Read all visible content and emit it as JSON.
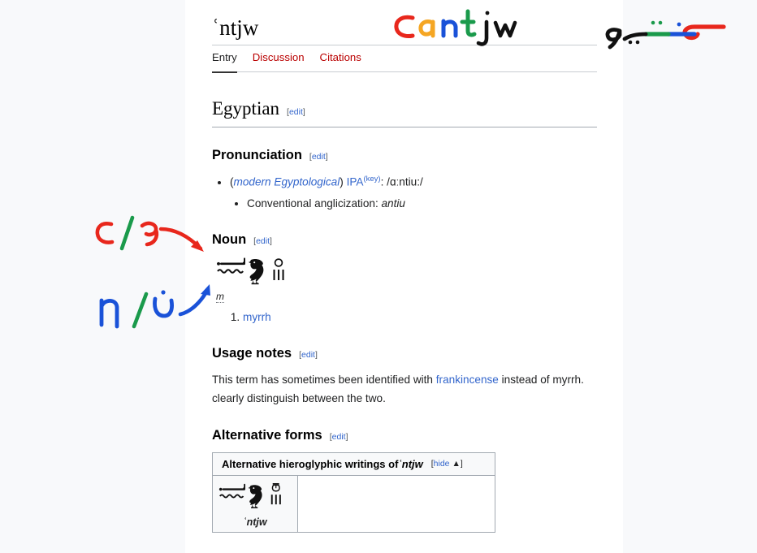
{
  "page": {
    "title": "ʿntjw",
    "background_color": "#f8f9fb",
    "content_color": "#ffffff"
  },
  "tabs": [
    {
      "label": "Entry",
      "selected": true,
      "color": "#202122"
    },
    {
      "label": "Discussion",
      "selected": false,
      "color": "#ba0000"
    },
    {
      "label": "Citations",
      "selected": false,
      "color": "#ba0000"
    }
  ],
  "language_section": {
    "heading": "Egyptian",
    "edit_open": "[",
    "edit_label": "edit",
    "edit_close": "]"
  },
  "pronunciation": {
    "heading": "Pronunciation",
    "register": "modern Egyptological",
    "ipa_label": "IPA",
    "ipa_key": "(key)",
    "ipa_colon": ":",
    "ipa_value": "/ɑːntiu:/",
    "anglicization_label": "Conventional anglicization:",
    "anglicization_value": "antiu",
    "open_paren": "(",
    "close_paren": ")"
  },
  "noun": {
    "heading": "Noun",
    "gender": "m",
    "definitions": [
      "myrrh"
    ]
  },
  "usage_notes": {
    "heading": "Usage notes",
    "text_before": "This term has sometimes been identified with ",
    "link": "frankincense",
    "text_after": " instead of myrrh.",
    "line2": "clearly distinguish between the two."
  },
  "alternative_forms": {
    "heading": "Alternative forms",
    "table_caption": "Alternative hieroglyphic writings of ",
    "table_caption_term": "ʿntjw",
    "hide_open": "[",
    "hide_label": "hide",
    "hide_arrow": "▲",
    "hide_close": "]",
    "cell_translit": "ʿntjw"
  },
  "annotations": {
    "top_latin": {
      "glyphs": [
        {
          "ch": "ʿ",
          "color": "#e8271c"
        },
        {
          "ch": "a",
          "color": "#f5a623"
        },
        {
          "ch": "n",
          "color": "#1a52d8"
        },
        {
          "ch": "t",
          "color": "#1a9a4b"
        },
        {
          "ch": "j",
          "color": "#111111"
        },
        {
          "ch": "w",
          "color": "#111111"
        }
      ],
      "text": "ʿantjw"
    },
    "top_arabic": {
      "text": "عنتيو",
      "colors": [
        "#e8271c",
        "#1a52d8",
        "#1a9a4b",
        "#111111"
      ]
    },
    "left_first": {
      "latin": "ʿ",
      "latin_color": "#e8271c",
      "slash": "/",
      "slash_color": "#1a9a4b",
      "arabic": "ع",
      "arabic_color": "#e8271c",
      "arrow_color": "#e8271c"
    },
    "left_second": {
      "latin": "n",
      "latin_color": "#1a52d8",
      "slash": "/",
      "slash_color": "#1a9a4b",
      "arabic": "ن",
      "arabic_color": "#1a52d8",
      "arrow_color": "#1a52d8"
    }
  },
  "colors": {
    "link_blue": "#3366cc",
    "link_red": "#ba0000",
    "text": "#202122",
    "rule": "#a2a9b1",
    "table_bg": "#f8f9fa"
  }
}
